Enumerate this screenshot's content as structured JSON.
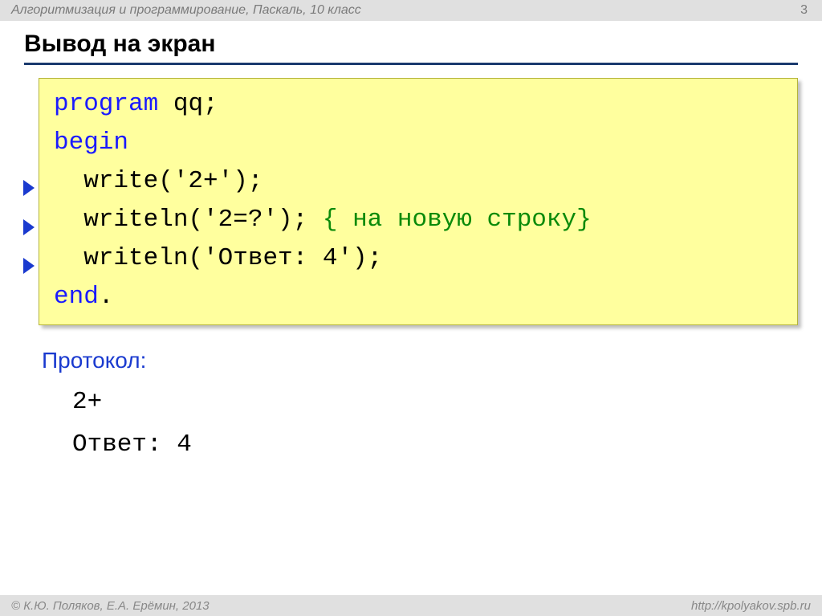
{
  "header": {
    "breadcrumb": "Алгоритмизация и программирование, Паскаль, 10 класс",
    "page_number": "3"
  },
  "title": "Вывод на экран",
  "code": {
    "l1": {
      "kw": "program",
      "rest": " qq;"
    },
    "l2": {
      "kw": "begin"
    },
    "l3": {
      "text": "  write('2+');"
    },
    "l4": {
      "text": "  writeln('2=?'); ",
      "comment": "{ на новую строку}"
    },
    "l5": {
      "text": "  writeln('Ответ: 4');"
    },
    "l6": {
      "kw": "end",
      "rest": "."
    }
  },
  "protocol": {
    "label": "Протокол:",
    "line1": "2+",
    "line2": "Ответ: 4"
  },
  "footer": {
    "copyright": "© К.Ю. Поляков, Е.А. Ерёмин, 2013",
    "url": "http://kpolyakov.spb.ru"
  }
}
